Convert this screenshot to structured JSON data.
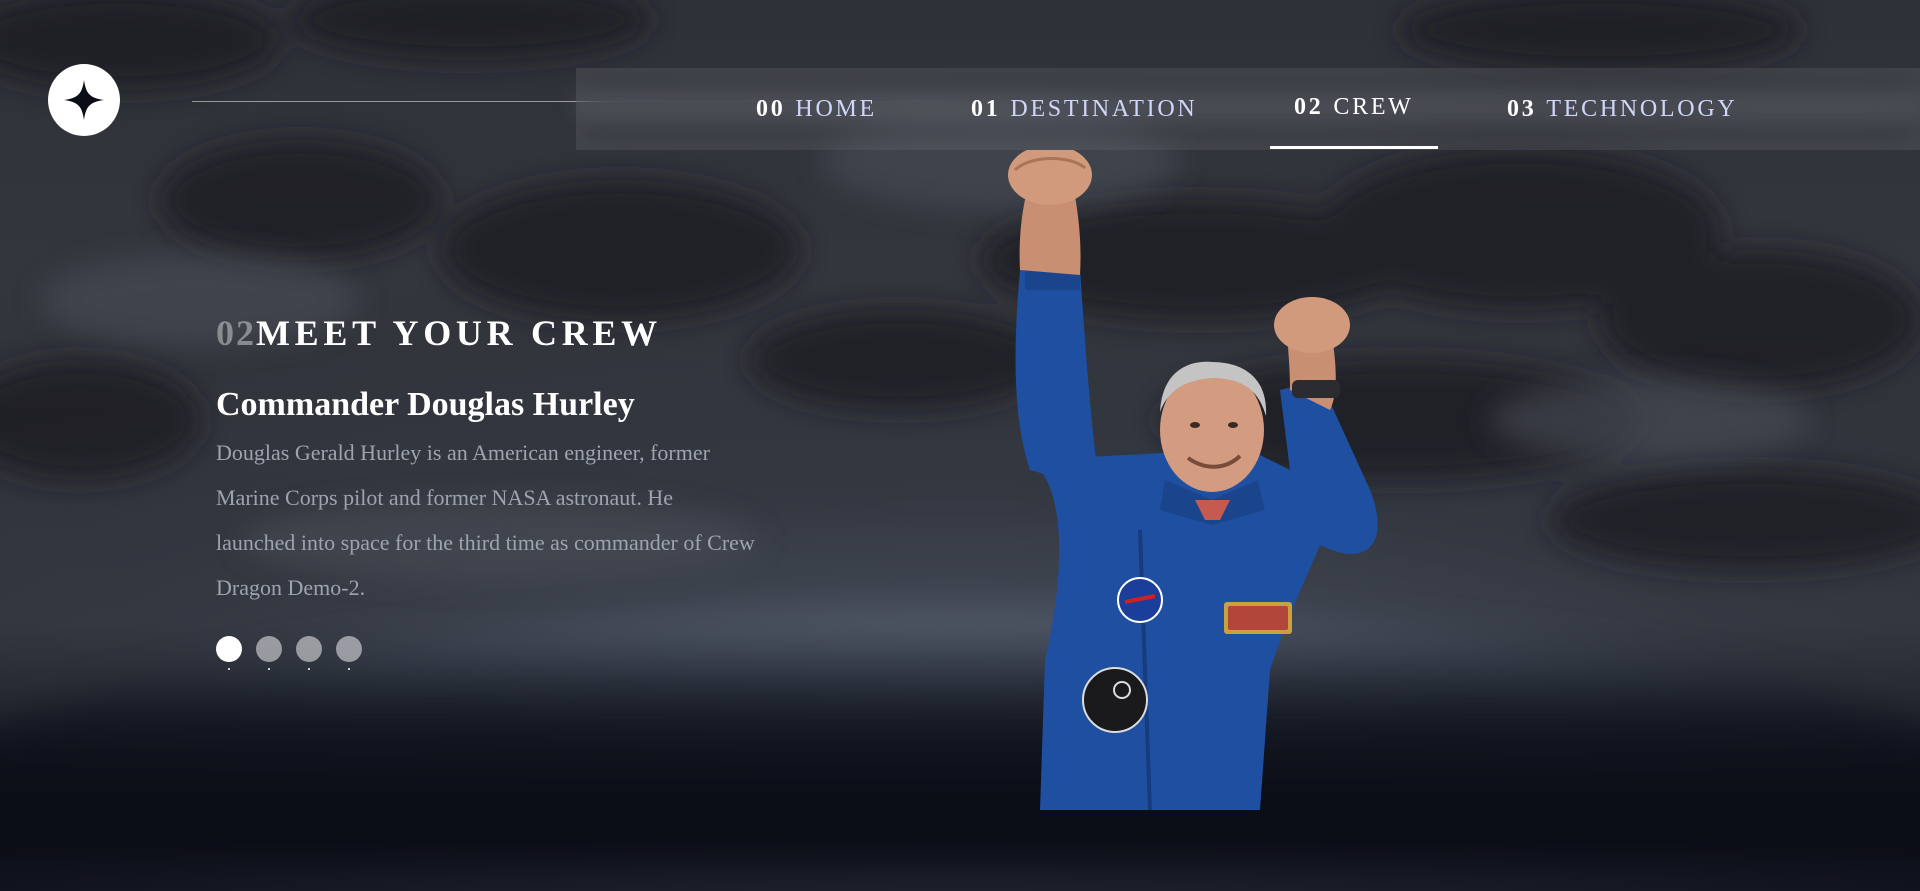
{
  "nav": {
    "items": [
      {
        "num": "00",
        "label": "HOME"
      },
      {
        "num": "01",
        "label": "DESTINATION"
      },
      {
        "num": "02",
        "label": "CREW"
      },
      {
        "num": "03",
        "label": "TECHNOLOGY"
      }
    ],
    "active_index": 2
  },
  "crew": {
    "heading_num": "02",
    "heading_text": "MEET YOUR CREW",
    "role_name": "Commander Douglas Hurley",
    "bio": "Douglas Gerald Hurley is an American engineer, former Marine Corps pilot and former NASA astronaut. He launched into space for the third time as commander of Crew Dragon Demo-2.",
    "slides_total": 4,
    "active_slide": 1
  },
  "icons": {
    "logo": "star-logo-icon"
  },
  "colors": {
    "background": "#0b0d17",
    "text": "#ffffff",
    "muted_text": "#9ea3b0",
    "accent_blue": "#1f4fa0"
  }
}
